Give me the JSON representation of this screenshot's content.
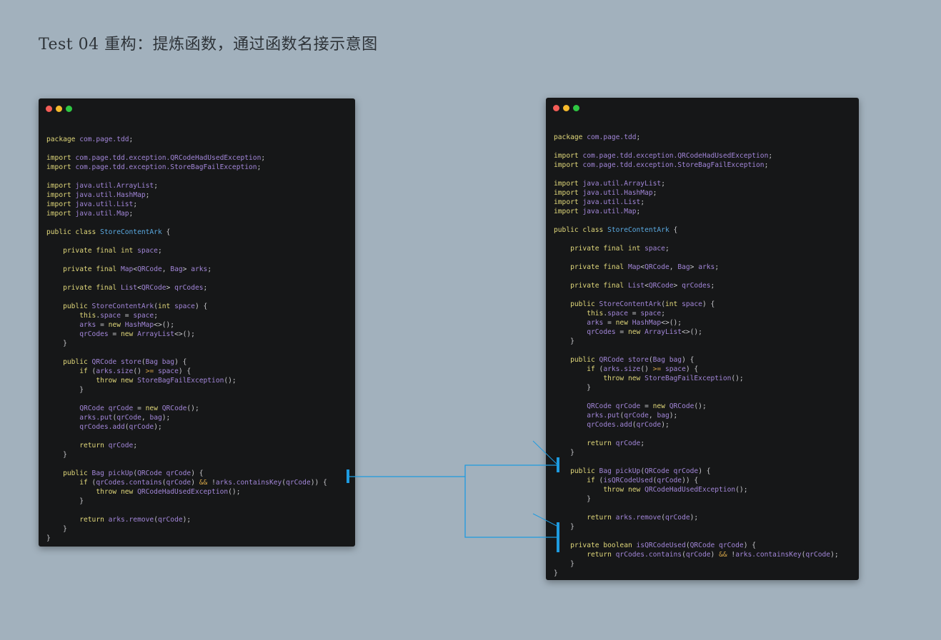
{
  "title": "Test 04 重构：提炼函数，通过函数名接示意图",
  "colors": {
    "background": "#a2b1bd",
    "window": "#161718",
    "keyword": "#e0d77a",
    "type": "#a286d8",
    "class_name": "#5aa9e0",
    "connector": "#1e9be0"
  },
  "before": {
    "lines": [
      [],
      [
        [
          "k",
          "package "
        ],
        [
          "t",
          "com.page.tdd"
        ],
        [
          "p",
          ";"
        ]
      ],
      [],
      [
        [
          "k",
          "import "
        ],
        [
          "t",
          "com.page.tdd.exception.QRCodeHadUsedException"
        ],
        [
          "p",
          ";"
        ]
      ],
      [
        [
          "k",
          "import "
        ],
        [
          "t",
          "com.page.tdd.exception.StoreBagFailException"
        ],
        [
          "p",
          ";"
        ]
      ],
      [],
      [
        [
          "k",
          "import "
        ],
        [
          "t",
          "java.util.ArrayList"
        ],
        [
          "p",
          ";"
        ]
      ],
      [
        [
          "k",
          "import "
        ],
        [
          "t",
          "java.util.HashMap"
        ],
        [
          "p",
          ";"
        ]
      ],
      [
        [
          "k",
          "import "
        ],
        [
          "t",
          "java.util.List"
        ],
        [
          "p",
          ";"
        ]
      ],
      [
        [
          "k",
          "import "
        ],
        [
          "t",
          "java.util.Map"
        ],
        [
          "p",
          ";"
        ]
      ],
      [],
      [
        [
          "k",
          "public class "
        ],
        [
          "cl",
          "StoreContentArk"
        ],
        [
          "p",
          " {"
        ]
      ],
      [],
      [
        [
          "p",
          "    "
        ],
        [
          "k",
          "private final int "
        ],
        [
          "t",
          "space"
        ],
        [
          "p",
          ";"
        ]
      ],
      [],
      [
        [
          "p",
          "    "
        ],
        [
          "k",
          "private final "
        ],
        [
          "t",
          "Map"
        ],
        [
          "p",
          "<"
        ],
        [
          "t",
          "QRCode"
        ],
        [
          "p",
          ", "
        ],
        [
          "t",
          "Bag"
        ],
        [
          "p",
          "> "
        ],
        [
          "t",
          "arks"
        ],
        [
          "p",
          ";"
        ]
      ],
      [],
      [
        [
          "p",
          "    "
        ],
        [
          "k",
          "private final "
        ],
        [
          "t",
          "List"
        ],
        [
          "p",
          "<"
        ],
        [
          "t",
          "QRCode"
        ],
        [
          "p",
          "> "
        ],
        [
          "t",
          "qrCodes"
        ],
        [
          "p",
          ";"
        ]
      ],
      [],
      [
        [
          "p",
          "    "
        ],
        [
          "k",
          "public "
        ],
        [
          "t",
          "StoreContentArk"
        ],
        [
          "p",
          "("
        ],
        [
          "k",
          "int "
        ],
        [
          "t",
          "space"
        ],
        [
          "p",
          ") {"
        ]
      ],
      [
        [
          "p",
          "        "
        ],
        [
          "k",
          "this"
        ],
        [
          "p",
          "."
        ],
        [
          "t",
          "space"
        ],
        [
          "p",
          " = "
        ],
        [
          "t",
          "space"
        ],
        [
          "p",
          ";"
        ]
      ],
      [
        [
          "p",
          "        "
        ],
        [
          "t",
          "arks"
        ],
        [
          "p",
          " = "
        ],
        [
          "k",
          "new "
        ],
        [
          "t",
          "HashMap"
        ],
        [
          "p",
          "<>();"
        ]
      ],
      [
        [
          "p",
          "        "
        ],
        [
          "t",
          "qrCodes"
        ],
        [
          "p",
          " = "
        ],
        [
          "k",
          "new "
        ],
        [
          "t",
          "ArrayList"
        ],
        [
          "p",
          "<>();"
        ]
      ],
      [
        [
          "p",
          "    }"
        ]
      ],
      [],
      [
        [
          "p",
          "    "
        ],
        [
          "k",
          "public "
        ],
        [
          "t",
          "QRCode store"
        ],
        [
          "p",
          "("
        ],
        [
          "t",
          "Bag bag"
        ],
        [
          "p",
          ") {"
        ]
      ],
      [
        [
          "p",
          "        "
        ],
        [
          "k",
          "if "
        ],
        [
          "p",
          "("
        ],
        [
          "t",
          "arks.size"
        ],
        [
          "p",
          "() "
        ],
        [
          "op",
          ">="
        ],
        [
          "t",
          " space"
        ],
        [
          "p",
          ") {"
        ]
      ],
      [
        [
          "p",
          "            "
        ],
        [
          "k",
          "throw new "
        ],
        [
          "t",
          "StoreBagFailException"
        ],
        [
          "p",
          "();"
        ]
      ],
      [
        [
          "p",
          "        }"
        ]
      ],
      [],
      [
        [
          "p",
          "        "
        ],
        [
          "t",
          "QRCode qrCode"
        ],
        [
          "p",
          " = "
        ],
        [
          "k",
          "new "
        ],
        [
          "t",
          "QRCode"
        ],
        [
          "p",
          "();"
        ]
      ],
      [
        [
          "p",
          "        "
        ],
        [
          "t",
          "arks.put"
        ],
        [
          "p",
          "("
        ],
        [
          "t",
          "qrCode"
        ],
        [
          "p",
          ", "
        ],
        [
          "t",
          "bag"
        ],
        [
          "p",
          ");"
        ]
      ],
      [
        [
          "p",
          "        "
        ],
        [
          "t",
          "qrCodes.add"
        ],
        [
          "p",
          "("
        ],
        [
          "t",
          "qrCode"
        ],
        [
          "p",
          ");"
        ]
      ],
      [],
      [
        [
          "p",
          "        "
        ],
        [
          "k",
          "return "
        ],
        [
          "t",
          "qrCode"
        ],
        [
          "p",
          ";"
        ]
      ],
      [
        [
          "p",
          "    }"
        ]
      ],
      [],
      [
        [
          "p",
          "    "
        ],
        [
          "k",
          "public "
        ],
        [
          "t",
          "Bag pickUp"
        ],
        [
          "p",
          "("
        ],
        [
          "t",
          "QRCode qrCode"
        ],
        [
          "p",
          ") {"
        ]
      ],
      [
        [
          "p",
          "        "
        ],
        [
          "k",
          "if "
        ],
        [
          "p",
          "("
        ],
        [
          "t",
          "qrCodes.contains"
        ],
        [
          "p",
          "("
        ],
        [
          "t",
          "qrCode"
        ],
        [
          "p",
          ") "
        ],
        [
          "op",
          "&&"
        ],
        [
          "p",
          " !"
        ],
        [
          "t",
          "arks.containsKey"
        ],
        [
          "p",
          "("
        ],
        [
          "t",
          "qrCode"
        ],
        [
          "p",
          ")) {"
        ]
      ],
      [
        [
          "p",
          "            "
        ],
        [
          "k",
          "throw new "
        ],
        [
          "t",
          "QRCodeHadUsedException"
        ],
        [
          "p",
          "();"
        ]
      ],
      [
        [
          "p",
          "        }"
        ]
      ],
      [],
      [
        [
          "p",
          "        "
        ],
        [
          "k",
          "return "
        ],
        [
          "t",
          "arks.remove"
        ],
        [
          "p",
          "("
        ],
        [
          "t",
          "qrCode"
        ],
        [
          "p",
          ");"
        ]
      ],
      [
        [
          "p",
          "    }"
        ]
      ],
      [
        [
          "p",
          "}"
        ]
      ]
    ]
  },
  "after": {
    "lines": [
      [],
      [
        [
          "k",
          "package "
        ],
        [
          "t",
          "com.page.tdd"
        ],
        [
          "p",
          ";"
        ]
      ],
      [],
      [
        [
          "k",
          "import "
        ],
        [
          "t",
          "com.page.tdd.exception.QRCodeHadUsedException"
        ],
        [
          "p",
          ";"
        ]
      ],
      [
        [
          "k",
          "import "
        ],
        [
          "t",
          "com.page.tdd.exception.StoreBagFailException"
        ],
        [
          "p",
          ";"
        ]
      ],
      [],
      [
        [
          "k",
          "import "
        ],
        [
          "t",
          "java.util.ArrayList"
        ],
        [
          "p",
          ";"
        ]
      ],
      [
        [
          "k",
          "import "
        ],
        [
          "t",
          "java.util.HashMap"
        ],
        [
          "p",
          ";"
        ]
      ],
      [
        [
          "k",
          "import "
        ],
        [
          "t",
          "java.util.List"
        ],
        [
          "p",
          ";"
        ]
      ],
      [
        [
          "k",
          "import "
        ],
        [
          "t",
          "java.util.Map"
        ],
        [
          "p",
          ";"
        ]
      ],
      [],
      [
        [
          "k",
          "public class "
        ],
        [
          "cl",
          "StoreContentArk"
        ],
        [
          "p",
          " {"
        ]
      ],
      [],
      [
        [
          "p",
          "    "
        ],
        [
          "k",
          "private final int "
        ],
        [
          "t",
          "space"
        ],
        [
          "p",
          ";"
        ]
      ],
      [],
      [
        [
          "p",
          "    "
        ],
        [
          "k",
          "private final "
        ],
        [
          "t",
          "Map"
        ],
        [
          "p",
          "<"
        ],
        [
          "t",
          "QRCode"
        ],
        [
          "p",
          ", "
        ],
        [
          "t",
          "Bag"
        ],
        [
          "p",
          "> "
        ],
        [
          "t",
          "arks"
        ],
        [
          "p",
          ";"
        ]
      ],
      [],
      [
        [
          "p",
          "    "
        ],
        [
          "k",
          "private final "
        ],
        [
          "t",
          "List"
        ],
        [
          "p",
          "<"
        ],
        [
          "t",
          "QRCode"
        ],
        [
          "p",
          "> "
        ],
        [
          "t",
          "qrCodes"
        ],
        [
          "p",
          ";"
        ]
      ],
      [],
      [
        [
          "p",
          "    "
        ],
        [
          "k",
          "public "
        ],
        [
          "t",
          "StoreContentArk"
        ],
        [
          "p",
          "("
        ],
        [
          "k",
          "int "
        ],
        [
          "t",
          "space"
        ],
        [
          "p",
          ") {"
        ]
      ],
      [
        [
          "p",
          "        "
        ],
        [
          "k",
          "this"
        ],
        [
          "p",
          "."
        ],
        [
          "t",
          "space"
        ],
        [
          "p",
          " = "
        ],
        [
          "t",
          "space"
        ],
        [
          "p",
          ";"
        ]
      ],
      [
        [
          "p",
          "        "
        ],
        [
          "t",
          "arks"
        ],
        [
          "p",
          " = "
        ],
        [
          "k",
          "new "
        ],
        [
          "t",
          "HashMap"
        ],
        [
          "p",
          "<>();"
        ]
      ],
      [
        [
          "p",
          "        "
        ],
        [
          "t",
          "qrCodes"
        ],
        [
          "p",
          " = "
        ],
        [
          "k",
          "new "
        ],
        [
          "t",
          "ArrayList"
        ],
        [
          "p",
          "<>();"
        ]
      ],
      [
        [
          "p",
          "    }"
        ]
      ],
      [],
      [
        [
          "p",
          "    "
        ],
        [
          "k",
          "public "
        ],
        [
          "t",
          "QRCode store"
        ],
        [
          "p",
          "("
        ],
        [
          "t",
          "Bag bag"
        ],
        [
          "p",
          ") {"
        ]
      ],
      [
        [
          "p",
          "        "
        ],
        [
          "k",
          "if "
        ],
        [
          "p",
          "("
        ],
        [
          "t",
          "arks.size"
        ],
        [
          "p",
          "() "
        ],
        [
          "op",
          ">="
        ],
        [
          "t",
          " space"
        ],
        [
          "p",
          ") {"
        ]
      ],
      [
        [
          "p",
          "            "
        ],
        [
          "k",
          "throw new "
        ],
        [
          "t",
          "StoreBagFailException"
        ],
        [
          "p",
          "();"
        ]
      ],
      [
        [
          "p",
          "        }"
        ]
      ],
      [],
      [
        [
          "p",
          "        "
        ],
        [
          "t",
          "QRCode qrCode"
        ],
        [
          "p",
          " = "
        ],
        [
          "k",
          "new "
        ],
        [
          "t",
          "QRCode"
        ],
        [
          "p",
          "();"
        ]
      ],
      [
        [
          "p",
          "        "
        ],
        [
          "t",
          "arks.put"
        ],
        [
          "p",
          "("
        ],
        [
          "t",
          "qrCode"
        ],
        [
          "p",
          ", "
        ],
        [
          "t",
          "bag"
        ],
        [
          "p",
          ");"
        ]
      ],
      [
        [
          "p",
          "        "
        ],
        [
          "t",
          "qrCodes.add"
        ],
        [
          "p",
          "("
        ],
        [
          "t",
          "qrCode"
        ],
        [
          "p",
          ");"
        ]
      ],
      [],
      [
        [
          "p",
          "        "
        ],
        [
          "k",
          "return "
        ],
        [
          "t",
          "qrCode"
        ],
        [
          "p",
          ";"
        ]
      ],
      [
        [
          "p",
          "    }"
        ]
      ],
      [],
      [
        [
          "p",
          "    "
        ],
        [
          "k",
          "public "
        ],
        [
          "t",
          "Bag pickUp"
        ],
        [
          "p",
          "("
        ],
        [
          "t",
          "QRCode qrCode"
        ],
        [
          "p",
          ") {"
        ]
      ],
      [
        [
          "p",
          "        "
        ],
        [
          "k",
          "if "
        ],
        [
          "p",
          "("
        ],
        [
          "t",
          "isQRCodeUsed"
        ],
        [
          "p",
          "("
        ],
        [
          "t",
          "qrCode"
        ],
        [
          "p",
          ")) {"
        ]
      ],
      [
        [
          "p",
          "            "
        ],
        [
          "k",
          "throw new "
        ],
        [
          "t",
          "QRCodeHadUsedException"
        ],
        [
          "p",
          "();"
        ]
      ],
      [
        [
          "p",
          "        }"
        ]
      ],
      [],
      [
        [
          "p",
          "        "
        ],
        [
          "k",
          "return "
        ],
        [
          "t",
          "arks.remove"
        ],
        [
          "p",
          "("
        ],
        [
          "t",
          "qrCode"
        ],
        [
          "p",
          ");"
        ]
      ],
      [
        [
          "p",
          "    }"
        ]
      ],
      [],
      [
        [
          "p",
          "    "
        ],
        [
          "k",
          "private boolean "
        ],
        [
          "t",
          "isQRCodeUsed"
        ],
        [
          "p",
          "("
        ],
        [
          "t",
          "QRCode qrCode"
        ],
        [
          "p",
          ") {"
        ]
      ],
      [
        [
          "p",
          "        "
        ],
        [
          "k",
          "return "
        ],
        [
          "t",
          "qrCodes.contains"
        ],
        [
          "p",
          "("
        ],
        [
          "t",
          "qrCode"
        ],
        [
          "p",
          ") "
        ],
        [
          "op",
          "&&"
        ],
        [
          "p",
          " !"
        ],
        [
          "t",
          "arks.containsKey"
        ],
        [
          "p",
          "("
        ],
        [
          "t",
          "qrCode"
        ],
        [
          "p",
          ");"
        ]
      ],
      [
        [
          "p",
          "    }"
        ]
      ],
      [
        [
          "p",
          "}"
        ]
      ]
    ]
  }
}
